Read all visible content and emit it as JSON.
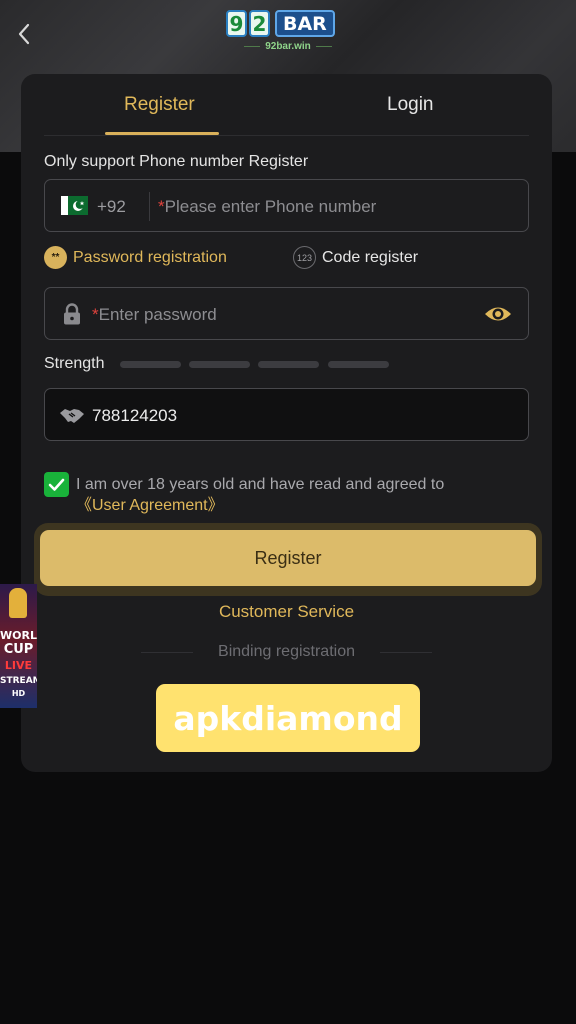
{
  "logo": {
    "digits": [
      "9",
      "2"
    ],
    "word": "BAR",
    "subtitle": "92bar.win"
  },
  "tabs": [
    {
      "label": "Register"
    },
    {
      "label": "Login"
    }
  ],
  "register": {
    "support_note": "Only support Phone number Register",
    "phone": {
      "country_code": "+92",
      "required_mark": "*",
      "placeholder": "Please enter Phone number"
    },
    "options": [
      {
        "icon": "**",
        "label": "Password registration"
      },
      {
        "icon": "123",
        "label": "Code register"
      }
    ],
    "password": {
      "required_mark": "*",
      "placeholder": "Enter password"
    },
    "strength_label": "Strength",
    "strength_level": 0,
    "invite_code": "788124203",
    "agreement": {
      "checked": true,
      "text": "I am over 18 years old and have read and agreed to",
      "link": "《User Agreement》"
    },
    "submit_label": "Register",
    "customer_service": "Customer Service",
    "binding_label": "Binding registration"
  },
  "promo": {
    "line1": "WORLD",
    "line2": "CUP",
    "line3": "LIVE",
    "line4": "STREAM",
    "line5": "HD"
  },
  "watermark": "apkdiamond",
  "colors": {
    "accent": "#e0b85a",
    "button": "#dcbb6a",
    "check": "#19b23a",
    "background": "#0b0b0c",
    "card": "#1c1c1e"
  }
}
